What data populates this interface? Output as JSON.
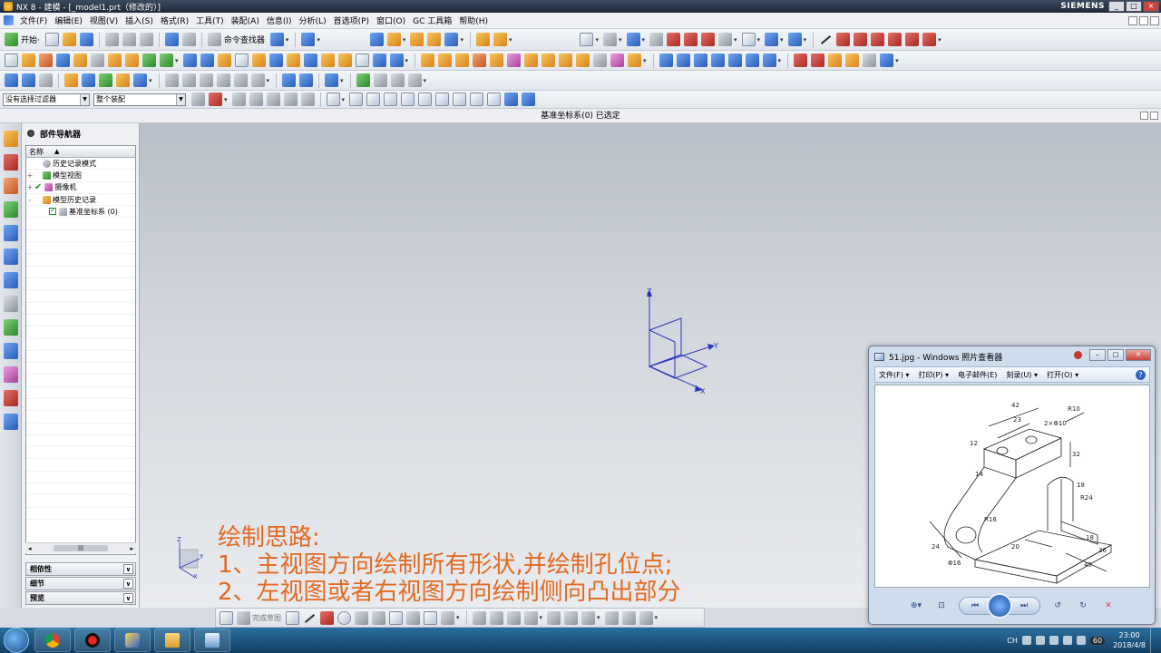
{
  "window": {
    "title": "NX 8 - 建模 - [_model1.prt（修改的）]",
    "brand": "SIEMENS",
    "buttons": [
      "_",
      "□",
      "×"
    ]
  },
  "menubar": {
    "items": [
      "文件(F)",
      "编辑(E)",
      "视图(V)",
      "插入(S)",
      "格式(R)",
      "工具(T)",
      "装配(A)",
      "信息(I)",
      "分析(L)",
      "首选项(P)",
      "窗口(O)",
      "GC 工具箱",
      "帮助(H)"
    ]
  },
  "toolbar": {
    "start_label": "开始·",
    "command_finder_label": "命令查找器"
  },
  "filter": {
    "selection_filter": "没有选择过滤器",
    "assembly_scope": "整个装配"
  },
  "cue_line": "基准坐标系(0) 已选定",
  "navigator": {
    "title": "部件导航器",
    "column_header": "名称",
    "sort_indicator": "▲",
    "rows": [
      {
        "label": "历史记录模式",
        "expander": ""
      },
      {
        "label": "模型视图",
        "expander": "+"
      },
      {
        "label": "摄像机",
        "expander": "+"
      },
      {
        "label": "模型历史记录",
        "expander": "-"
      },
      {
        "label": "基准坐标系 (0)",
        "expander": ""
      }
    ],
    "scroll_thumb": "|||",
    "scroll_left": "◂",
    "scroll_right": "▸",
    "sections": [
      "相依性",
      "细节",
      "预览"
    ],
    "section_chevron": "∨"
  },
  "csys": {
    "axes": [
      "Z",
      "Y",
      "X"
    ]
  },
  "overlay": {
    "line1": "绘制思路:",
    "line2": "1、主视图方向绘制所有形状,并绘制孔位点;",
    "line3": "2、左视图或者右视图方向绘制侧向凸出部分"
  },
  "sketchbar": {
    "finish_label": "完成草图"
  },
  "viewer": {
    "title": "51.jpg - Windows 照片查看器",
    "menu": [
      "文件(F) ▾",
      "打印(P) ▾",
      "电子邮件(E)",
      "刻录(U) ▾",
      "打开(O) ▾"
    ],
    "help": "?",
    "buttons": [
      "–",
      "□",
      "✕"
    ],
    "drawing_dims": [
      "42",
      "23",
      "R10",
      "2×Φ10",
      "12",
      "32",
      "14",
      "18",
      "R24",
      "R16",
      "Φ16",
      "20",
      "18",
      "24",
      "45",
      "36"
    ],
    "controls": [
      "⊕▾",
      "⊡",
      "⏮",
      "▭",
      "⏭",
      "↺",
      "↻",
      "✕"
    ]
  },
  "taskbar": {
    "tray_lang": "CH",
    "tray_badge": "60",
    "time": "23:00",
    "date": "2018/4/8"
  }
}
